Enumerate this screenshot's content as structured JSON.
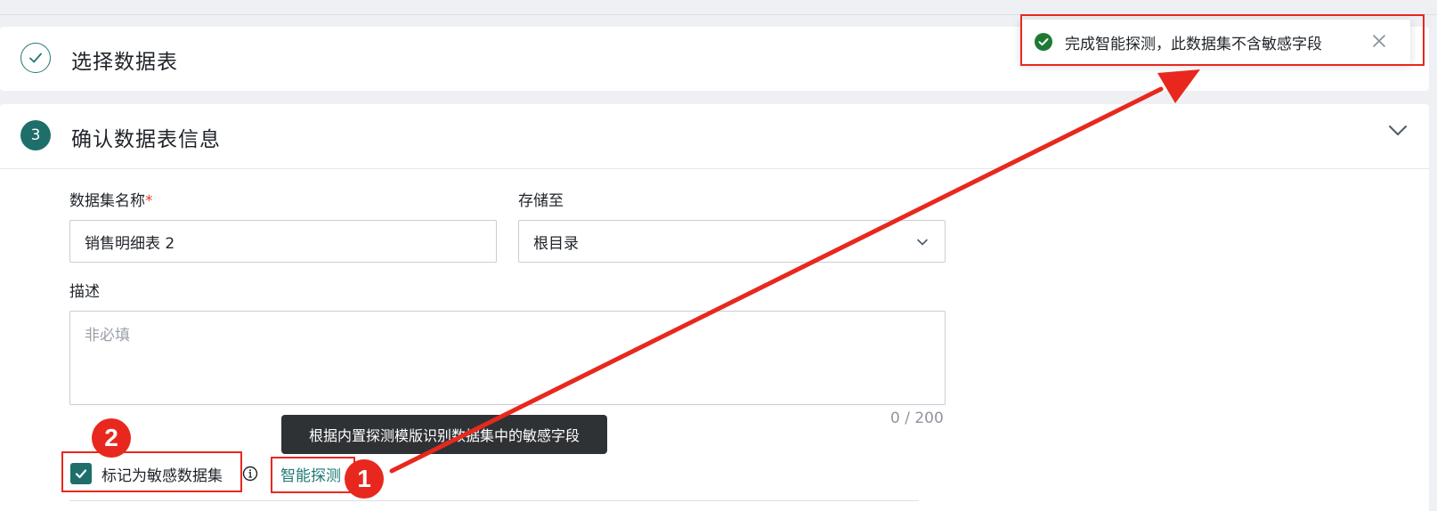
{
  "steps": {
    "step2": {
      "title": "选择数据表",
      "state": "done"
    },
    "step3": {
      "number": "3",
      "title": "确认数据表信息"
    }
  },
  "form": {
    "name_label": "数据集名称",
    "name_required_mark": "*",
    "name_value": "销售明细表 2",
    "storage_label": "存储至",
    "storage_value": "根目录",
    "desc_label": "描述",
    "desc_placeholder": "非必填",
    "desc_counter": "0 / 200",
    "sensitive_checkbox_label": "标记为敏感数据集",
    "sensitive_checked": true,
    "smart_detect_link": "智能探测"
  },
  "tooltip": {
    "text": "根据内置探测模版识别数据集中的敏感字段"
  },
  "toast": {
    "text": "完成智能探测，此数据集不含敏感字段",
    "status": "success"
  },
  "annotations": {
    "badge1": "1",
    "badge2": "2"
  },
  "colors": {
    "accent": "#1e6f6b",
    "annotation": "#e8281e",
    "success": "#1d7a34"
  }
}
